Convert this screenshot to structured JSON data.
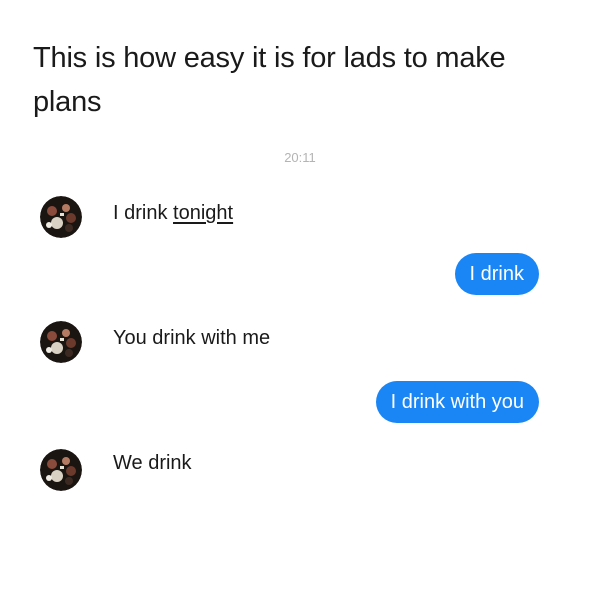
{
  "caption": {
    "text": "This is how easy it is for lads to make plans"
  },
  "chat": {
    "timestamp": "20:11",
    "messages": [
      {
        "sender": "friend",
        "text_before": "I drink ",
        "text_underlined": "tonight"
      },
      {
        "sender": "me",
        "text": "I drink"
      },
      {
        "sender": "friend",
        "text": "You drink with me"
      },
      {
        "sender": "me",
        "text": "I drink with you"
      },
      {
        "sender": "friend",
        "text": "We drink"
      }
    ]
  },
  "colors": {
    "outgoing_bubble": "#1a86f5",
    "timestamp": "#b4b4b4"
  },
  "icons": {
    "avatar": "group-photo-avatar-icon"
  }
}
